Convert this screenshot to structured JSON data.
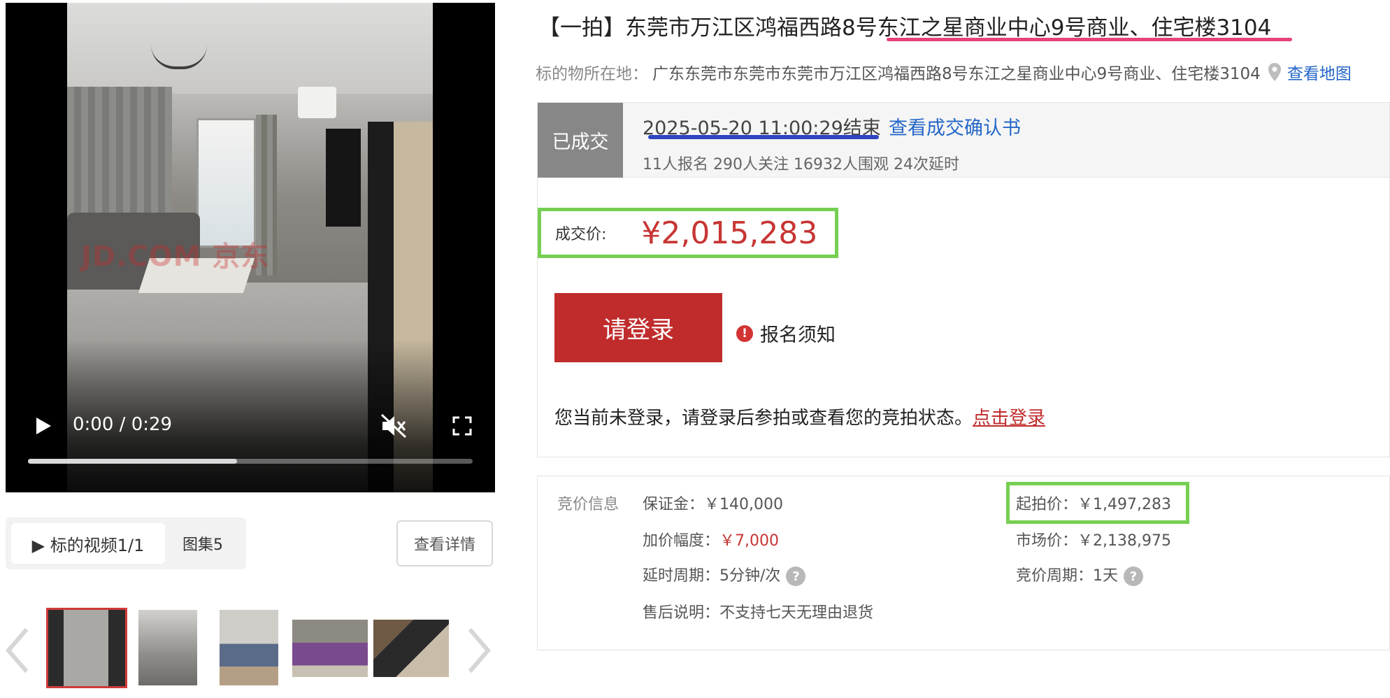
{
  "video": {
    "current_time": "0:00",
    "duration": "0:29",
    "time_separator": "/",
    "progress_fraction": 0.47,
    "watermark": "JD.COM 京东"
  },
  "media_tabs": {
    "video_tab_label": "▶ 标的视频1/1",
    "gallery_tab_label": "图集5",
    "detail_button_label": "查看详情"
  },
  "title": "【一拍】东莞市万江区鸿福西路8号东江之星商业中心9号商业、住宅楼3104",
  "location": {
    "label": "标的物所在地：",
    "value": "广东东莞市东莞市东莞市万江区鸿福西路8号东江之星商业中心9号商业、住宅楼3104",
    "map_link": "查看地图"
  },
  "status": {
    "badge": "已成交",
    "end_time": "2025-05-20 11:00:29结束",
    "confirm_link": "查看成交确认书",
    "stats": "11人报名  290人关注  16932人围观  24次延时"
  },
  "deal": {
    "label": "成交价:",
    "value": "¥2,015,283"
  },
  "login": {
    "button_label": "请登录",
    "notice_label": "报名须知",
    "hint_text": "您当前未登录，请登录后参拍或查看您的竞拍状态。",
    "hint_link": "点击登录"
  },
  "bid_info": {
    "section_title": "竞价信息",
    "deposit_label": "保证金：",
    "deposit_value": "￥140,000",
    "increment_label": "加价幅度：",
    "increment_value": "￥7,000",
    "delay_label": "延时周期：",
    "delay_value": "5分钟/次",
    "aftersale_label": "售后说明：",
    "aftersale_value": "不支持七天无理由退货",
    "start_label": "起拍价：",
    "start_value": "￥1,497,283",
    "market_label": "市场价：",
    "market_value": "￥2,138,975",
    "period_label": "竞价周期：",
    "period_value": "1天"
  },
  "colors": {
    "accent_red": "#c02c2c",
    "price_red": "#c73533",
    "link_blue": "#2466c8",
    "highlight_green": "#76cf52",
    "title_underline_pink": "#e6427d",
    "time_underline_blue": "#2f45c0"
  }
}
